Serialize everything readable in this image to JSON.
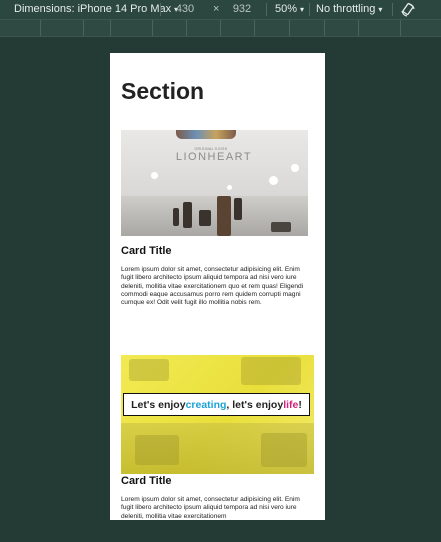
{
  "devtools": {
    "dimensions_label": "Dimensions: iPhone 14 Pro Max",
    "width_value": "430",
    "times": "×",
    "height_value": "932",
    "zoom": "50%",
    "throttling": "No throttling",
    "caret": "▾",
    "rotate_icon": "rotate-icon"
  },
  "page": {
    "section_title": "Section",
    "cards": [
      {
        "title": "Card Title",
        "image": {
          "brand_small": "ORIGINAL KIOSK",
          "brand": "LIONHEART"
        },
        "text": "Lorem ipsum dolor sit amet, consectetur adipisicing elit. Enim fugit libero architecto ipsum aliquid tempora ad nisi vero iure deleniti, mollitia vitae exercitationem quo et rem quas! Eligendi commodi eaque accusamus porro rem quidem corrupti magni cumque ex! Odit velit fugit illo mollitia nobis rem."
      },
      {
        "title": "Card Title",
        "image": {
          "banner_part1": "Let's enjoy ",
          "banner_part2": "creating",
          "banner_part3": ", let's enjoy ",
          "banner_part4": "life",
          "banner_part5": "!"
        },
        "text": "Lorem ipsum dolor sit amet, consectetur adipisicing elit. Enim fugit libero architecto ipsum aliquid tempora ad nisi vero iure deleniti, mollitia vitae exercitationem"
      }
    ]
  },
  "colors": {
    "backdrop": "#243b35",
    "toolbar": "#2c4640",
    "accent_blue": "#1ba3d6",
    "accent_pink": "#d1237d",
    "poster_yellow": "#f2ea53"
  }
}
